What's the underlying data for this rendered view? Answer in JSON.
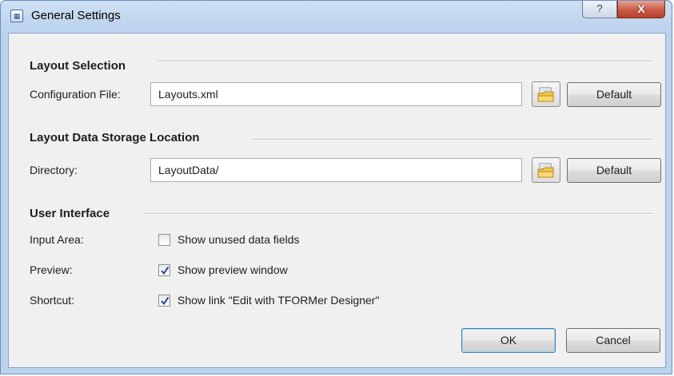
{
  "window": {
    "title": "General Settings",
    "help_label": "?",
    "close_label": "X"
  },
  "sections": {
    "layout_selection": "Layout Selection",
    "storage": "Layout Data Storage Location",
    "ui": "User Interface"
  },
  "config": {
    "label": "Configuration File:",
    "value": "Layouts.xml",
    "default_label": "Default"
  },
  "directory": {
    "label": "Directory:",
    "value": "LayoutData/",
    "default_label": "Default"
  },
  "ui_options": {
    "input_area": {
      "label": "Input Area:",
      "checkbox_label": "Show unused data fields",
      "checked": false
    },
    "preview": {
      "label": "Preview:",
      "checkbox_label": "Show preview window",
      "checked": true
    },
    "shortcut": {
      "label": "Shortcut:",
      "checkbox_label": "Show link \"Edit with TFORMer Designer\"",
      "checked": true
    }
  },
  "buttons": {
    "ok": "OK",
    "cancel": "Cancel"
  },
  "icons": {
    "app": "app-icon",
    "browse": "folder-browse-icon",
    "check": "checkmark-icon"
  },
  "colors": {
    "titlebar": "#bcd3ed",
    "close": "#c75a44",
    "check": "#1f4e9a"
  }
}
